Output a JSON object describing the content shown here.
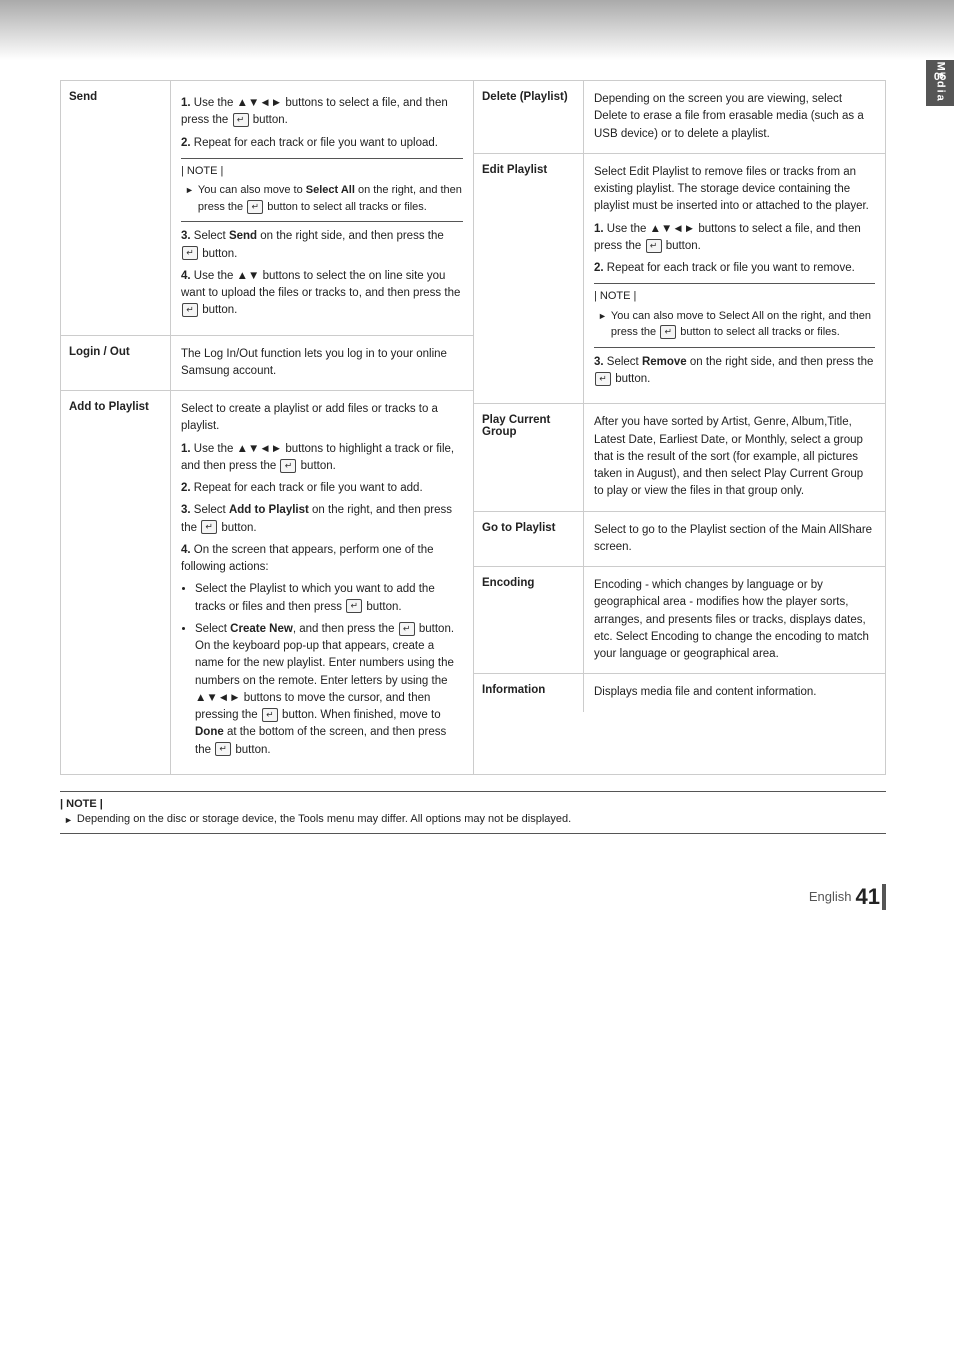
{
  "page": {
    "top_bar_decoration": "decorative gradient bar",
    "side_label": "Media Play",
    "side_chapter": "05",
    "footer": {
      "language_label": "English",
      "page_number": "41"
    }
  },
  "left_table": {
    "rows": [
      {
        "label": "Send",
        "content_paragraphs": [
          "1. Use the ▲▼◄► buttons to select a file, and then press the [E] button.",
          "2. Repeat for each track or file you want to upload.",
          "| NOTE |",
          "► You can also move to Select All on the right, and then press the [E] button to select all tracks or files.",
          "3. Select Send on the right side, and then press the [E] button.",
          "4. Use the ▲▼ buttons to select the on line site you want to upload the files or tracks to, and then press the [E] button."
        ]
      },
      {
        "label": "Login / Out",
        "content_paragraphs": [
          "The Log In/Out function lets you log in to your online Samsung account."
        ]
      },
      {
        "label": "Add to Playlist",
        "content_paragraphs": [
          "Select to create a playlist or add files or tracks to a playlist.",
          "1. Use the ▲▼◄► buttons to highlight a track or file, and then press the [E] button.",
          "2. Repeat for each track or file you want to add.",
          "3. Select Add to Playlist on the right, and then press the [E] button.",
          "4. On the screen that appears, perform one of the following actions:",
          "• Select the Playlist to which you want to add the tracks or files and then press [E] button.",
          "• Select Create New, and then press the [E] button. On the keyboard pop-up that appears, create a name for the new playlist. Enter numbers using the numbers on the remote. Enter letters by using the ▲▼◄► buttons to move the cursor, and then pressing the [E] button. When finished, move to Done at the bottom of the screen, and then press the [E] button."
        ]
      }
    ]
  },
  "right_table": {
    "rows": [
      {
        "label": "Delete (Playlist)",
        "content_paragraphs": [
          "Depending on the screen you are viewing, select Delete to erase a file from erasable media (such as a USB device) or to delete a playlist."
        ]
      },
      {
        "label": "Edit Playlist",
        "content_paragraphs": [
          "Select Edit Playlist to remove files or tracks from an existing playlist. The storage device containing the playlist must be inserted into or attached to the player.",
          "1. Use the ▲▼◄► buttons to select a file, and then press the [E] button.",
          "2. Repeat for each track or file you want to remove.",
          "| NOTE |",
          "► You can also move to Select All on the right, and then press the [E] button to select all tracks or files.",
          "3. Select Remove on the right side, and then press the [E] button."
        ]
      },
      {
        "label": "Play Current Group",
        "content_paragraphs": [
          "After you have sorted by Artist, Genre, Album,Title, Latest Date, Earliest Date, or Monthly, select a group that is the result of the sort (for example, all pictures taken in August), and then select Play Current Group to play or view the files in that group only."
        ]
      },
      {
        "label": "Go to Playlist",
        "content_paragraphs": [
          "Select to go to the Playlist section of the Main AllShare screen."
        ]
      },
      {
        "label": "Encoding",
        "content_paragraphs": [
          "Encoding - which changes by language or by geographical area - modifies how the player sorts, arranges, and presents files or tracks, displays dates, etc. Select Encoding to change the encoding to match your language or geographical area."
        ]
      },
      {
        "label": "Information",
        "content_paragraphs": [
          "Displays media file and content information."
        ]
      }
    ]
  },
  "bottom_note": {
    "title": "| NOTE |",
    "items": [
      "Depending on the disc or storage device, the Tools menu may differ. All options may not be displayed."
    ]
  },
  "icons": {
    "enter_button": "[E]",
    "dpad": "▲▼◄►",
    "dpad_ud": "▲▼",
    "arrow": "►"
  }
}
